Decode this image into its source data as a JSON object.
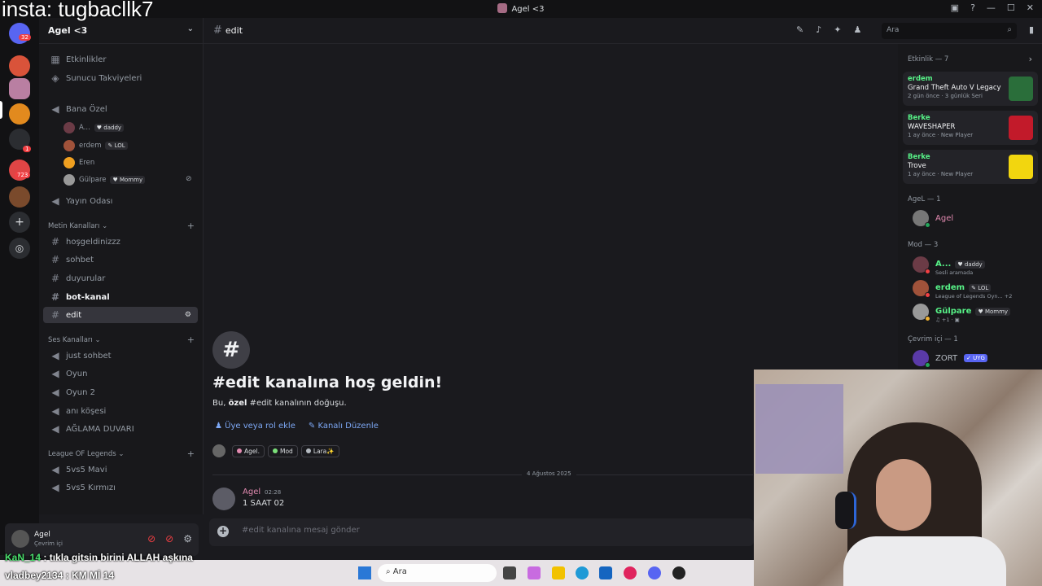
{
  "overlay": {
    "insta": "insta: tugbacllk7"
  },
  "window": {
    "title": "Agel <3"
  },
  "servers": {
    "home_badge": "32",
    "badge_red": "1",
    "badge_723": "723"
  },
  "guild": {
    "name": "Agel <3"
  },
  "sidebar": {
    "events": "Etkinlikler",
    "boosts": "Sunucu Takviyeleri",
    "bana_ozel": "Bana Özel",
    "voice_users": [
      {
        "name": "A...",
        "tag": "♥ daddy"
      },
      {
        "name": "erdem",
        "tag": "✎ LOL"
      },
      {
        "name": "Eren",
        "tag": ""
      },
      {
        "name": "Gülpare",
        "tag": "♥ Mommy"
      }
    ],
    "stream_room": "Yayın Odası",
    "text_category": "Metin Kanalları",
    "text_channels": [
      "hoşgeldinizzz",
      "sohbet",
      "duyurular",
      "bot-kanal",
      "edit"
    ],
    "voice_category": "Ses Kanalları",
    "voice_channels": [
      "just sohbet",
      "Oyun",
      "Oyun 2",
      "anı köşesi",
      "AĞLAMA DUVARI"
    ],
    "lol_category": "League OF Legends",
    "lol_channels": [
      "5vs5 Mavi",
      "5vs5 Kırmızı"
    ]
  },
  "user": {
    "name": "Agel",
    "status": "Çevrim içi"
  },
  "header": {
    "channel": "edit",
    "search_placeholder": "Ara"
  },
  "welcome": {
    "title": "#edit kanalına hoş geldin!",
    "sub_prefix": "Bu, ",
    "sub_bold": "özel",
    "sub_suffix": " #edit kanalının doğuşu.",
    "add_member": "Üye veya rol ekle",
    "edit_channel": "Kanalı Düzenle",
    "roles": [
      {
        "name": "Agel.",
        "color": "#e28ab0"
      },
      {
        "name": "Mod",
        "color": "#7be07a"
      },
      {
        "name": "Lara✨",
        "color": "#b5bac1"
      }
    ]
  },
  "messages": {
    "date_divider": "4 Ağustos 2025",
    "author": "Agel",
    "time": "02:28",
    "text": "1 SAAT 02"
  },
  "composer": {
    "placeholder": "#edit kanalına mesaj gönder"
  },
  "members": {
    "activity_header": "Etkinlik — 7",
    "activities": [
      {
        "who": "erdem",
        "game": "Grand Theft Auto V Legacy",
        "meta": "2 gün önce · 3 günlük Seri",
        "color": "#2a6e3a"
      },
      {
        "who": "Berke",
        "game": "WAVESHAPER",
        "meta": "1 ay önce · New Player",
        "color": "#c21a2a"
      },
      {
        "who": "Berke",
        "game": "Trove",
        "meta": "1 ay önce · New Player",
        "color": "#f2d60f"
      }
    ],
    "group_agel": "AgeL — 1",
    "agel_member": "Agel",
    "group_mod": "Mod — 3",
    "mods": [
      {
        "name": "A...",
        "tag": "♥ daddy",
        "sub": "Sesli aramada",
        "color": "#57f287"
      },
      {
        "name": "erdem",
        "tag": "✎ LOL",
        "sub": "League of Legends Oyn... +2",
        "color": "#57f287"
      },
      {
        "name": "Gülpare",
        "tag": "♥ Mommy",
        "sub": "♫ +1 · ▣",
        "color": "#57f287"
      }
    ],
    "group_online": "Çevrim içi — 1",
    "online_member": "ZORT",
    "online_tag": "✓ UYG"
  },
  "stream_chat": [
    {
      "user": "KaN_14",
      "text": " : tıkla gitsin birini ALLAH aşkına"
    },
    {
      "user": "vladbey2134",
      "text": " : KM Mİ 14"
    }
  ],
  "taskbar": {
    "search": "Ara"
  }
}
